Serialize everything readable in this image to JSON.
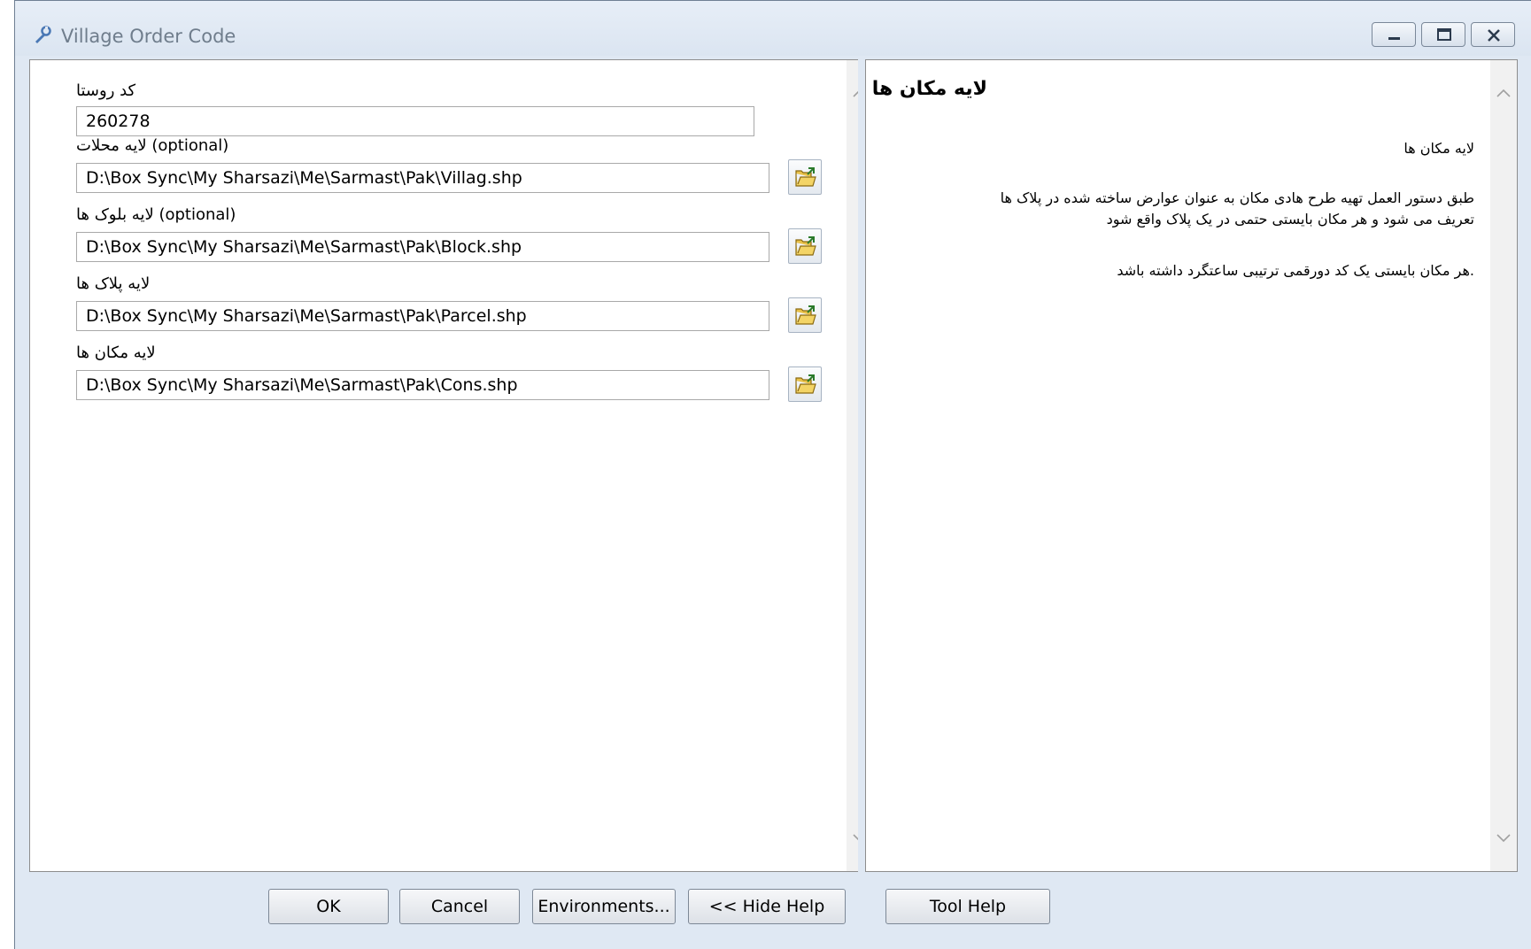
{
  "window": {
    "title": "Village Order Code"
  },
  "form": {
    "village_code": {
      "label": "کد روستا",
      "value": "260278"
    },
    "neighborhoods_layer": {
      "label": "لایه محلات (optional)",
      "value": "D:\\Box Sync\\My Sharsazi\\Me\\Sarmast\\Pak\\Villag.shp"
    },
    "blocks_layer": {
      "label": "لایه بلوک ها (optional)",
      "value": "D:\\Box Sync\\My Sharsazi\\Me\\Sarmast\\Pak\\Block.shp"
    },
    "parcels_layer": {
      "label": "لایه پلاک ها",
      "value": "D:\\Box Sync\\My Sharsazi\\Me\\Sarmast\\Pak\\Parcel.shp"
    },
    "places_layer": {
      "label": "لایه مکان ها",
      "value": "D:\\Box Sync\\My Sharsazi\\Me\\Sarmast\\Pak\\Cons.shp"
    }
  },
  "help": {
    "title": "لایه مکان ها",
    "subtitle": "لایه مکان ها",
    "para1_line1": "طبق دستور العمل تهیه طرح هادی مکان به عنوان عوارض ساخته شده در پلاک ها",
    "para1_line2": "تعریف می شود و هر مکان بایستی حتمی در یک پلاک واقع شود",
    "para2": ".هر مکان بایستی یک کد دورقمی ترتیبی ساعتگرد داشته باشد"
  },
  "buttons": {
    "ok": "OK",
    "cancel": "Cancel",
    "environments": "Environments...",
    "hide_help": "<< Hide Help",
    "tool_help": "Tool Help"
  },
  "icons": {
    "app": "toolbox-tool-icon",
    "browse": "open-folder-icon",
    "minimize": "minimize-icon",
    "maximize": "maximize-icon",
    "close": "close-icon",
    "scroll_up": "chevron-up-icon",
    "scroll_down": "chevron-down-icon"
  }
}
